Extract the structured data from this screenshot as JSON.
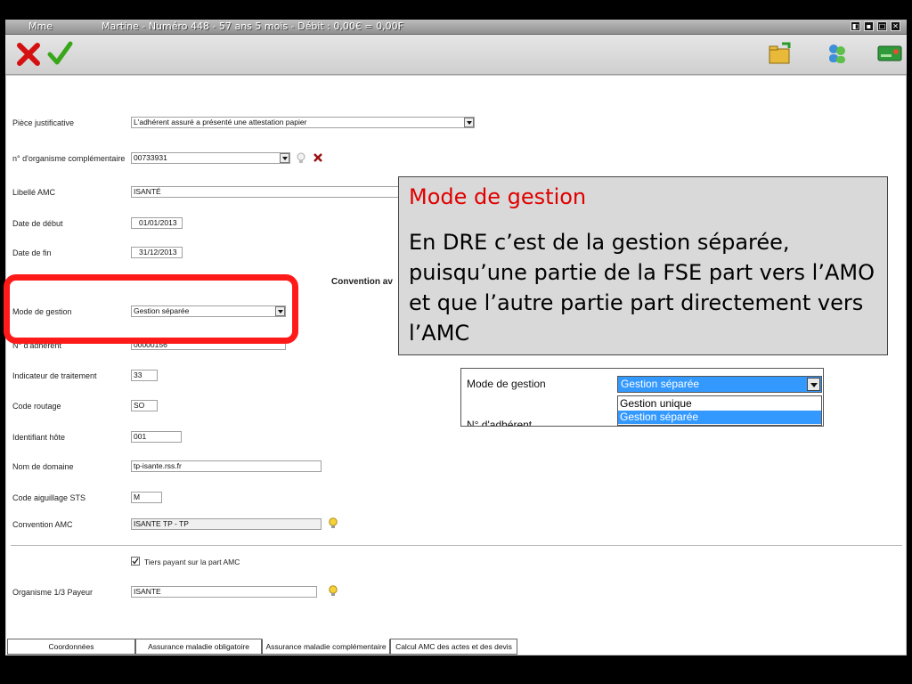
{
  "window": {
    "title_salutation": "Mme",
    "title_main": "Martine - Numéro 448  -  57 ans 5 mois  - Débit : 0,00€ = 0,00F"
  },
  "toolbar": {
    "cancel_icon": "red-x-icon",
    "validate_icon": "green-check-icon",
    "folder_icon": "folder-icon",
    "users_icon": "users-icon",
    "card_icon": "vitale-card-icon"
  },
  "form": {
    "piece_label": "Pièce justificative",
    "piece_value": "L'adhérent assuré a présenté une attestation papier",
    "organisme_label": "n° d'organisme complémentaire",
    "organisme_value": "00733931",
    "libelle_label": "Libellé AMC",
    "libelle_value": "ISANTÉ",
    "debut_label": "Date de début",
    "debut_value": "01/01/2013",
    "fin_label": "Date de fin",
    "fin_value": "31/12/2013",
    "convention_heading": "Convention av",
    "mode_label": "Mode de gestion",
    "mode_value": "Gestion séparée",
    "adherent_label": "N° d'adhérent",
    "adherent_value": "00000156",
    "indicateur_label": "Indicateur de traitement",
    "indicateur_value": "33",
    "routage_label": "Code routage",
    "routage_value": "SO",
    "hote_label": "Identifiant hôte",
    "hote_value": "001",
    "domaine_label": "Nom de domaine",
    "domaine_value": "tp-isante.rss.fr",
    "sts_label": "Code aiguillage STS",
    "sts_value": "M",
    "convention_label": "Convention AMC",
    "convention_value": "ISANTE TP - TP",
    "tiers_label": "Tiers payant sur la part AMC",
    "payeur_label": "Organisme 1/3 Payeur",
    "payeur_value": "ISANTE"
  },
  "callout": {
    "title": "Mode de gestion",
    "body": "En DRE c’est de la gestion séparée, puisqu’une partie de la FSE part vers l’AMO et que l’autre partie part directement vers l’AMC"
  },
  "zoom": {
    "label": "Mode de gestion",
    "selected": "Gestion séparée",
    "options": [
      "Gestion unique",
      "Gestion séparée"
    ],
    "partial_label": "N° d'adhérent"
  },
  "tabs": [
    "Coordonnées",
    "Assurance maladie obligatoire",
    "Assurance maladie complémentaire",
    "Calcul AMC des actes et des devis"
  ],
  "colors": {
    "highlight_red": "#ff1a1a",
    "callout_title": "#e00000",
    "selection_blue": "#3399ff"
  }
}
